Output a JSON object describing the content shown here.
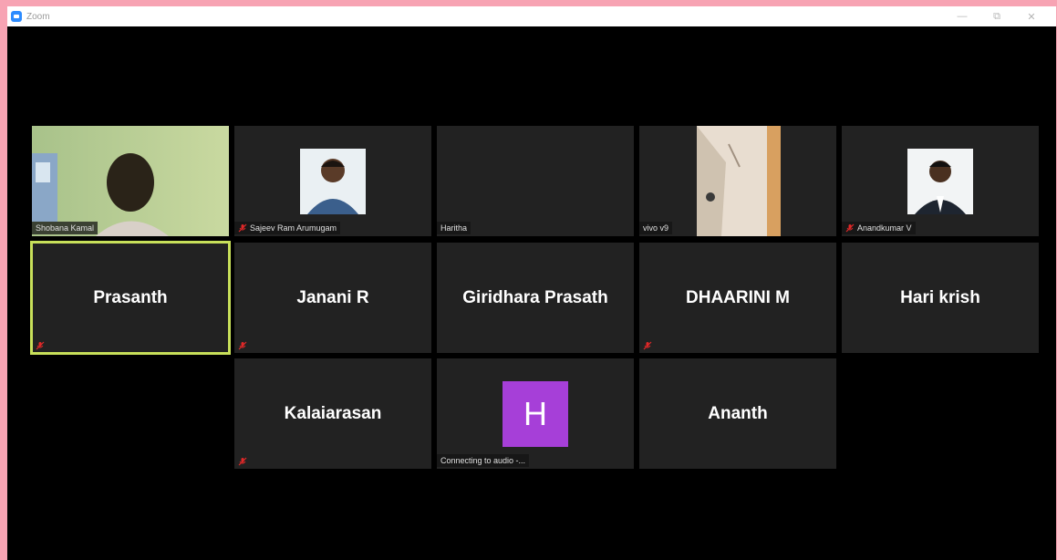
{
  "window": {
    "title": "Zoom",
    "controls": {
      "minimize": "—",
      "restore": "⧉",
      "close": "✕"
    }
  },
  "participants": [
    {
      "name": "Shobana Kamal",
      "video": true
    },
    {
      "name": "Sajeev Ram Arumugam",
      "video": false,
      "muted": true
    },
    {
      "name": "Haritha",
      "video": false
    },
    {
      "name": "vivo v9",
      "video": true
    },
    {
      "name": "Anandkumar V",
      "video": false,
      "muted": true
    },
    {
      "name": "Prasanth",
      "muted": true,
      "active_speaker": true
    },
    {
      "name": "Janani R",
      "muted": true
    },
    {
      "name": "Giridhara Prasath"
    },
    {
      "name": "DHAARINI M",
      "muted": true
    },
    {
      "name": "Hari krish"
    },
    {
      "name": "Kalaiarasan",
      "muted": true
    },
    {
      "name": "",
      "avatar_letter": "H",
      "status": "Connecting to audio -..."
    },
    {
      "name": "Ananth"
    }
  ],
  "colors": {
    "tile_bg": "#222222",
    "active_border": "#c8e05a",
    "avatar_purple": "#a63fd8",
    "mute_red": "#e02828",
    "desktop_pink": "#f7a3b3"
  }
}
